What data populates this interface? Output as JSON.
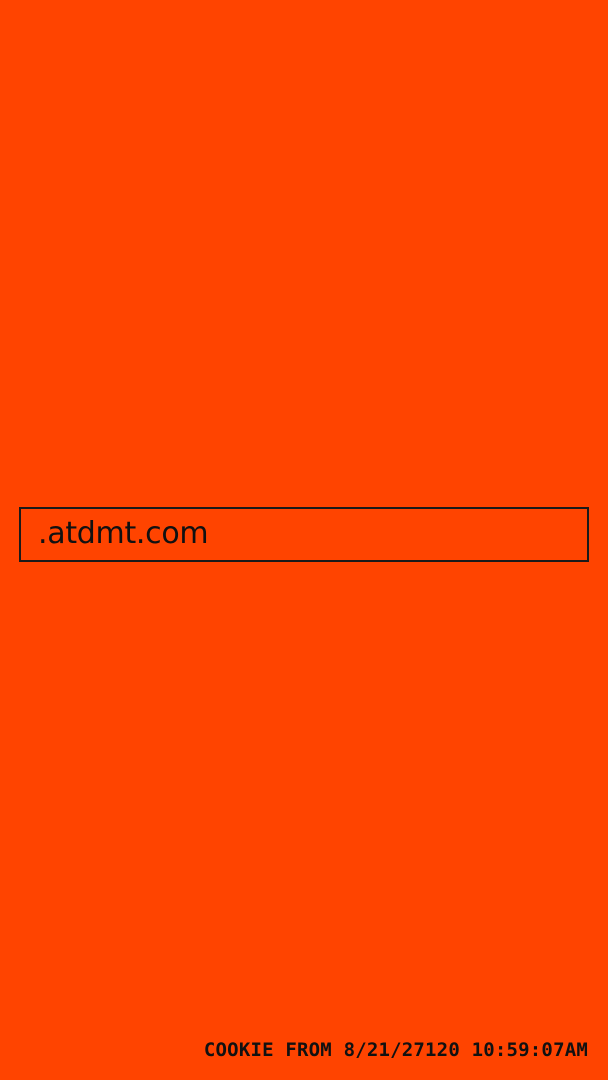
{
  "screen": {
    "background_color": "#ff4400",
    "text_color": "#111111",
    "border_color": "#1a1a1a"
  },
  "cookie": {
    "domain": ".atdmt.com",
    "footer": "COOKIE FROM 8/21/27120 10:59:07AM"
  }
}
